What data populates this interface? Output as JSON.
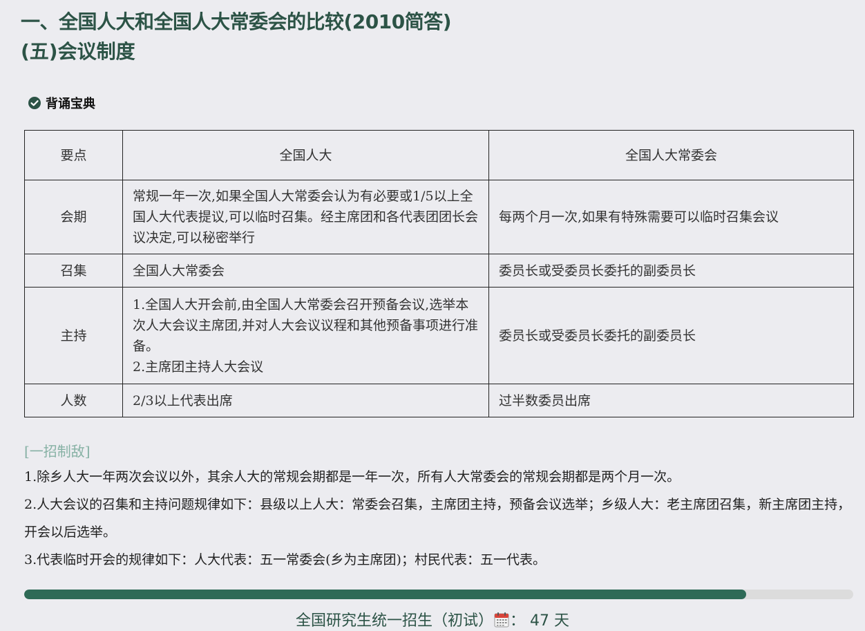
{
  "heading": {
    "line1": "一、全国人大和全国人大常委会的比较(2010简答)",
    "line2": "(五)会议制度"
  },
  "badge": {
    "label": "背诵宝典"
  },
  "table": {
    "headers": [
      "要点",
      "全国人大",
      "全国人大常委会"
    ],
    "rows": [
      {
        "key": "会期",
        "npc": [
          "常规一年一次,如果全国人大常委会认为有必要或1/5以上全国人大代表提议,可以临时召集。经主席团和各代表团团长会议决定,可以秘密举行"
        ],
        "standing": "每两个月一次,如果有特殊需要可以临时召集会议"
      },
      {
        "key": "召集",
        "npc": [
          "全国人大常委会"
        ],
        "standing": "委员长或受委员长委托的副委员长"
      },
      {
        "key": "主持",
        "npc": [
          "1.全国人大开会前,由全国人大常委会召开预备会议,选举本次人大会议主席团,并对人大会议议程和其他预备事项进行准备。",
          "2.主席团主持人大会议"
        ],
        "standing": "委员长或受委员长委托的副委员长"
      },
      {
        "key": "人数",
        "npc": [
          "2/3以上代表出席"
        ],
        "standing": "过半数委员出席"
      }
    ]
  },
  "tips": {
    "title": "[一招制敌]",
    "items": [
      "1.除乡人大一年两次会议以外，其余人大的常规会期都是一年一次，所有人大常委会的常规会期都是两个月一次。",
      "2.人大会议的召集和主持问题规律如下：县级以上人大：常委会召集，主席团主持，预备会议选举；乡级人大：老主席团召集，新主席团主持，开会以后选举。",
      "3.代表临时开会的规律如下：人大代表：五一常委会(乡为主席团)；村民代表：五一代表。"
    ]
  },
  "progress": {
    "fraction": 0.871
  },
  "countdown": {
    "prefix": "全国研究生统一招生（初试）",
    "separator": "：",
    "days": "47",
    "unit": "天",
    "icon": "calendar-icon"
  },
  "colors": {
    "heading": "#2c5346",
    "accent": "#2e6a56",
    "tip_title": "#86b1a4"
  }
}
